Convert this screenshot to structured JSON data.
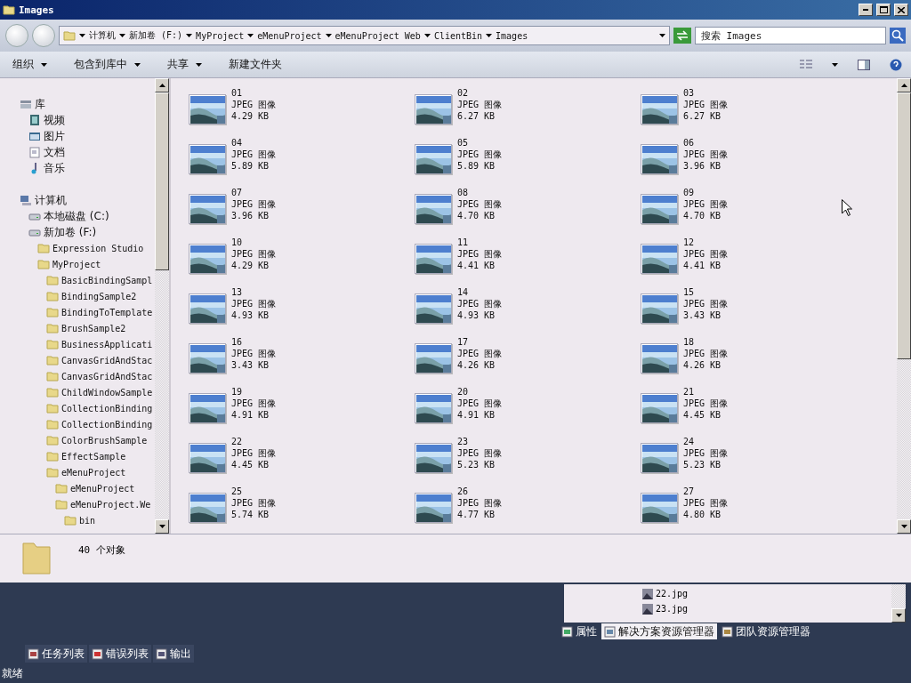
{
  "window": {
    "title": "Images"
  },
  "address": {
    "segments": [
      "计算机",
      "新加卷 (F:)",
      "MyProject",
      "eMenuProject",
      "eMenuProject Web",
      "ClientBin",
      "Images"
    ]
  },
  "search": {
    "placeholder": "搜索 Images"
  },
  "toolbar": {
    "buttons": [
      {
        "label": "组织",
        "dropdown": true
      },
      {
        "label": "包含到库中",
        "dropdown": true
      },
      {
        "label": "共享",
        "dropdown": true
      },
      {
        "label": "新建文件夹",
        "dropdown": false
      }
    ]
  },
  "nav_pane": {
    "groups": [
      {
        "label": "库",
        "kind": "library",
        "children": [
          {
            "label": "视频",
            "kind": "video"
          },
          {
            "label": "图片",
            "kind": "pictures"
          },
          {
            "label": "文档",
            "kind": "documents"
          },
          {
            "label": "音乐",
            "kind": "music"
          }
        ]
      },
      {
        "label": "计算机",
        "kind": "computer",
        "children": [
          {
            "label": "本地磁盘 (C:)",
            "kind": "disk"
          },
          {
            "label": "新加卷 (F:)",
            "kind": "disk",
            "children": [
              {
                "label": "Expression Studio",
                "kind": "folder"
              },
              {
                "label": "MyProject",
                "kind": "folder",
                "children": [
                  {
                    "label": "BasicBindingSampl",
                    "kind": "folder"
                  },
                  {
                    "label": "BindingSample2",
                    "kind": "folder"
                  },
                  {
                    "label": "BindingToTemplate",
                    "kind": "folder"
                  },
                  {
                    "label": "BrushSample2",
                    "kind": "folder"
                  },
                  {
                    "label": "BusinessApplicati",
                    "kind": "folder"
                  },
                  {
                    "label": "CanvasGridAndStac",
                    "kind": "folder"
                  },
                  {
                    "label": "CanvasGridAndStac",
                    "kind": "folder"
                  },
                  {
                    "label": "ChildWindowSample",
                    "kind": "folder"
                  },
                  {
                    "label": "CollectionBinding",
                    "kind": "folder"
                  },
                  {
                    "label": "CollectionBinding",
                    "kind": "folder"
                  },
                  {
                    "label": "ColorBrushSample",
                    "kind": "folder"
                  },
                  {
                    "label": "EffectSample",
                    "kind": "folder"
                  },
                  {
                    "label": "eMenuProject",
                    "kind": "folder",
                    "children": [
                      {
                        "label": "eMenuProject",
                        "kind": "folder"
                      },
                      {
                        "label": "eMenuProject.We",
                        "kind": "folder",
                        "children": [
                          {
                            "label": "bin",
                            "kind": "folder"
                          }
                        ]
                      }
                    ]
                  }
                ]
              }
            ]
          }
        ]
      }
    ]
  },
  "files": [
    {
      "name": "01",
      "type": "JPEG 图像",
      "size": "4.29 KB"
    },
    {
      "name": "02",
      "type": "JPEG 图像",
      "size": "6.27 KB"
    },
    {
      "name": "03",
      "type": "JPEG 图像",
      "size": "6.27 KB"
    },
    {
      "name": "04",
      "type": "JPEG 图像",
      "size": "5.89 KB"
    },
    {
      "name": "05",
      "type": "JPEG 图像",
      "size": "5.89 KB"
    },
    {
      "name": "06",
      "type": "JPEG 图像",
      "size": "3.96 KB"
    },
    {
      "name": "07",
      "type": "JPEG 图像",
      "size": "3.96 KB"
    },
    {
      "name": "08",
      "type": "JPEG 图像",
      "size": "4.70 KB"
    },
    {
      "name": "09",
      "type": "JPEG 图像",
      "size": "4.70 KB"
    },
    {
      "name": "10",
      "type": "JPEG 图像",
      "size": "4.29 KB"
    },
    {
      "name": "11",
      "type": "JPEG 图像",
      "size": "4.41 KB"
    },
    {
      "name": "12",
      "type": "JPEG 图像",
      "size": "4.41 KB"
    },
    {
      "name": "13",
      "type": "JPEG 图像",
      "size": "4.93 KB"
    },
    {
      "name": "14",
      "type": "JPEG 图像",
      "size": "4.93 KB"
    },
    {
      "name": "15",
      "type": "JPEG 图像",
      "size": "3.43 KB"
    },
    {
      "name": "16",
      "type": "JPEG 图像",
      "size": "3.43 KB"
    },
    {
      "name": "17",
      "type": "JPEG 图像",
      "size": "4.26 KB"
    },
    {
      "name": "18",
      "type": "JPEG 图像",
      "size": "4.26 KB"
    },
    {
      "name": "19",
      "type": "JPEG 图像",
      "size": "4.91 KB"
    },
    {
      "name": "20",
      "type": "JPEG 图像",
      "size": "4.91 KB"
    },
    {
      "name": "21",
      "type": "JPEG 图像",
      "size": "4.45 KB"
    },
    {
      "name": "22",
      "type": "JPEG 图像",
      "size": "4.45 KB"
    },
    {
      "name": "23",
      "type": "JPEG 图像",
      "size": "5.23 KB"
    },
    {
      "name": "24",
      "type": "JPEG 图像",
      "size": "5.23 KB"
    },
    {
      "name": "25",
      "type": "JPEG 图像",
      "size": "5.74 KB"
    },
    {
      "name": "26",
      "type": "JPEG 图像",
      "size": "4.77 KB"
    },
    {
      "name": "27",
      "type": "JPEG 图像",
      "size": "4.80 KB"
    }
  ],
  "details": {
    "count": "40 个对象"
  },
  "ide": {
    "solution_items": [
      "22.jpg",
      "23.jpg"
    ],
    "panel_tabs": [
      {
        "label": "属性",
        "selected": false
      },
      {
        "label": "解决方案资源管理器",
        "selected": true
      },
      {
        "label": "团队资源管理器",
        "selected": false
      }
    ],
    "bottom_tabs": [
      "任务列表",
      "错误列表",
      "输出"
    ],
    "status": "就绪"
  }
}
